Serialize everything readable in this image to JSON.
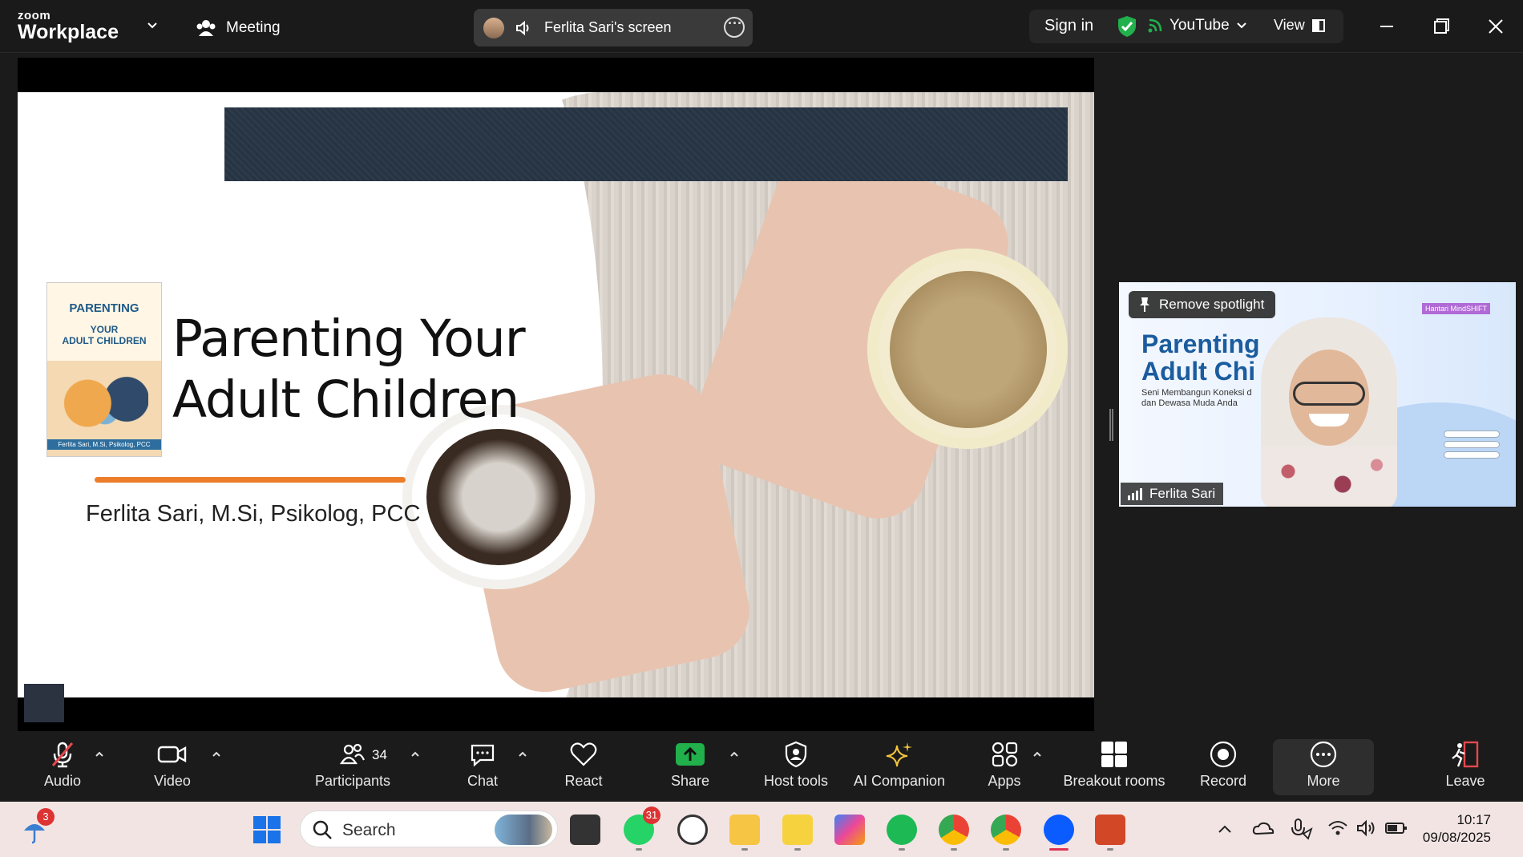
{
  "app": {
    "brand_top": "zoom",
    "brand_main": "Workplace"
  },
  "topbar": {
    "meeting_label": "Meeting",
    "screen_label": "Ferlita Sari's screen",
    "signin_label": "Sign in",
    "stream_label": "YouTube",
    "view_label": "View",
    "accent_green": "#21b04b"
  },
  "slide": {
    "title_line1": "Parenting Your",
    "title_line2": "Adult Children",
    "author": "Ferlita Sari, M.Si, Psikolog, PCC",
    "book_title": "PARENTING",
    "book_your": "YOUR",
    "book_sub": "ADULT CHILDREN",
    "book_author": "Ferlita Sari, M.Si, Psikolog, PCC",
    "underline_color": "#ec7d2b"
  },
  "spotlight": {
    "remove_label": "Remove spotlight",
    "participant_name": "Ferlita Sari",
    "bg_title_line1": "Parenting",
    "bg_title_line2": "Adult Chi",
    "bg_sub_line1": "Seni Membangun Koneksi d",
    "bg_sub_line2": "dan Dewasa Muda Anda",
    "bg_brand": "Hantari MindSHIFT"
  },
  "toolbar": {
    "audio": "Audio",
    "video": "Video",
    "participants": "Participants",
    "participants_count": "34",
    "chat": "Chat",
    "react": "React",
    "share": "Share",
    "host_tools": "Host tools",
    "ai_companion": "AI Companion",
    "apps": "Apps",
    "breakout": "Breakout rooms",
    "record": "Record",
    "more": "More",
    "leave": "Leave",
    "share_color": "#21b04b",
    "mute_color": "#e5484d"
  },
  "taskbar": {
    "search_placeholder": "Search",
    "weather_badge": "3",
    "whatsapp_badge": "31",
    "time": "10:17",
    "date": "09/08/2025"
  }
}
